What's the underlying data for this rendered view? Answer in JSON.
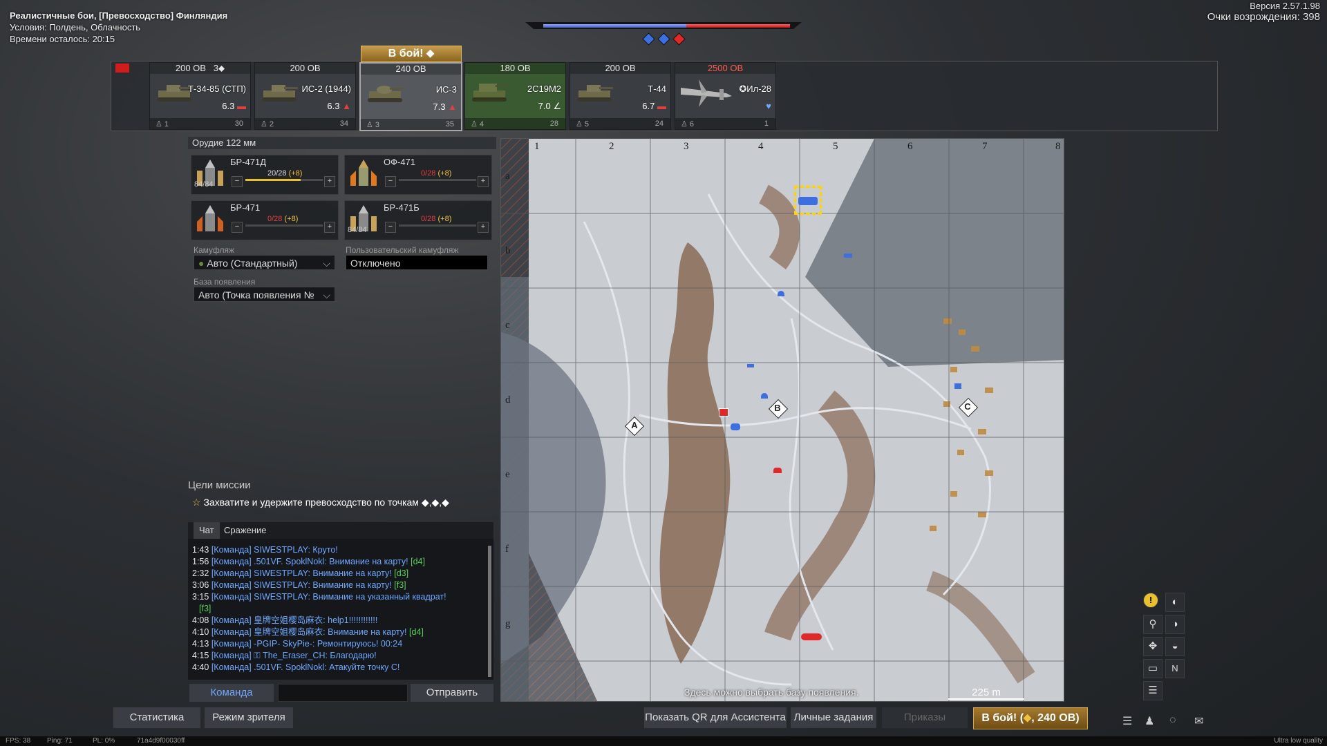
{
  "info": {
    "mode": "Реалистичные бои, [Превосходство] Финляндия",
    "conditions": "Условия: Полдень, Облачность",
    "time_left": "Времени осталось: 20:15"
  },
  "version": "Версия 2.57.1.98",
  "respawn_points": "Очки возрождения: 398",
  "score": {
    "team_blue_fraction": 0.58,
    "team_red_fraction": 0.42,
    "zones": [
      "blue",
      "blue",
      "red"
    ]
  },
  "tobattle_tab": "В бой!",
  "vehicles": [
    {
      "cost": "200 ОВ",
      "extra": "3",
      "name": "Т-34-85 (СТП)",
      "br": "6.3",
      "num": "1",
      "stat": "30"
    },
    {
      "cost": "200 ОВ",
      "extra": "",
      "name": "ИС-2 (1944)",
      "br": "6.3",
      "num": "2",
      "stat": "34"
    },
    {
      "cost": "240 ОВ",
      "extra": "",
      "name": "ИС-3",
      "br": "7.3",
      "num": "3",
      "stat": "35"
    },
    {
      "cost": "180 ОВ",
      "extra": "",
      "name": "2С19М2",
      "br": "7.0",
      "num": "4",
      "stat": "28"
    },
    {
      "cost": "200 ОВ",
      "extra": "",
      "name": "Т-44",
      "br": "6.7",
      "num": "5",
      "stat": "24"
    },
    {
      "cost": "2500 ОВ",
      "extra": "",
      "name": "Ил-28",
      "br": "",
      "num": "6",
      "stat": "1"
    }
  ],
  "weapon_title": "Орудие 122 мм",
  "shells": [
    {
      "name": "БР-471Д",
      "count": "20/28",
      "plus": "(+8)",
      "stock": "84/84",
      "fill": 0.71
    },
    {
      "name": "ОФ-471",
      "count": "0/28",
      "plus": "(+8)",
      "stock": "",
      "fill": 0
    },
    {
      "name": "БР-471",
      "count": "0/28",
      "plus": "(+8)",
      "stock": "",
      "fill": 0
    },
    {
      "name": "БР-471Б",
      "count": "0/28",
      "plus": "(+8)",
      "stock": "84/84",
      "fill": 0
    }
  ],
  "camo_label": "Камуфляж",
  "camo_value": "Авто (Стандартный)",
  "custom_camo_label": "Пользовательский камуфляж",
  "custom_camo_value": "Отключено",
  "spawn_label": "База появления",
  "spawn_value": "Авто (Точка появления №",
  "mission_title": "Цели миссии",
  "mission_text": "Захватите и удержите превосходство по точкам ◆,◆,◆",
  "chat_tabs": [
    "Чат",
    "Сражение"
  ],
  "chat": [
    {
      "t": "1:43",
      "m": "[Команда] SIWESTPLAY: Круто!",
      "g": ""
    },
    {
      "t": "1:56",
      "m": "[Команда] .501VF. SpoklNokl: Внимание на карту!",
      "g": "[d4]"
    },
    {
      "t": "2:32",
      "m": "[Команда] SIWESTPLAY: Внимание на карту!",
      "g": "[d3]"
    },
    {
      "t": "3:06",
      "m": "[Команда] SIWESTPLAY: Внимание на карту!",
      "g": "[f3]"
    },
    {
      "t": "3:15",
      "m": "[Команда] SIWESTPLAY: Внимание на указанный квадрат!",
      "g": ""
    },
    {
      "t": "",
      "m": "",
      "g": "[f3]"
    },
    {
      "t": "4:08",
      "m": "[Команда] 皇牌空姐樱岛麻衣: help1!!!!!!!!!!!!",
      "g": ""
    },
    {
      "t": "4:10",
      "m": "[Команда] 皇牌空姐樱岛麻衣: Внимание на карту!",
      "g": "[d4]"
    },
    {
      "t": "4:13",
      "m": "[Команда] -PGIP- SkyPie-: Ремонтируюсь! 00:24",
      "g": ""
    },
    {
      "t": "4:15",
      "m": "[Команда] ⚿ The_Eraser_CH: Благодарю!",
      "g": ""
    },
    {
      "t": "4:40",
      "m": "[Команда] .501VF. SpoklNokl: Атакуйте точку С!",
      "g": ""
    }
  ],
  "chat_channel": "Команда",
  "chat_send": "Отправить",
  "map": {
    "cols": [
      "1",
      "2",
      "3",
      "4",
      "5",
      "6",
      "7",
      "8"
    ],
    "rows": [
      "a",
      "b",
      "c",
      "d",
      "e",
      "f",
      "g"
    ],
    "points": [
      "A",
      "B",
      "C"
    ],
    "hint": "Здесь можно выбрать базу появления.",
    "scale": "225 m"
  },
  "bottom": {
    "stats": "Статистика",
    "spectator": "Режим зрителя",
    "qr": "Показать QR для Ассистента",
    "tasks": "Личные задания",
    "orders": "Приказы",
    "battle": "В бой! (",
    "battle_cost": ", 240 ОВ)"
  },
  "footer": {
    "fps": "FPS: 38",
    "ping": "Ping: 71",
    "pl": "PL: 0%",
    "id": "71a4d9f00030ff",
    "quality": "Ultra low quality"
  },
  "colors": {
    "blue": "#3d6fe0",
    "red": "#e02828",
    "gold": "#c59a4a"
  }
}
